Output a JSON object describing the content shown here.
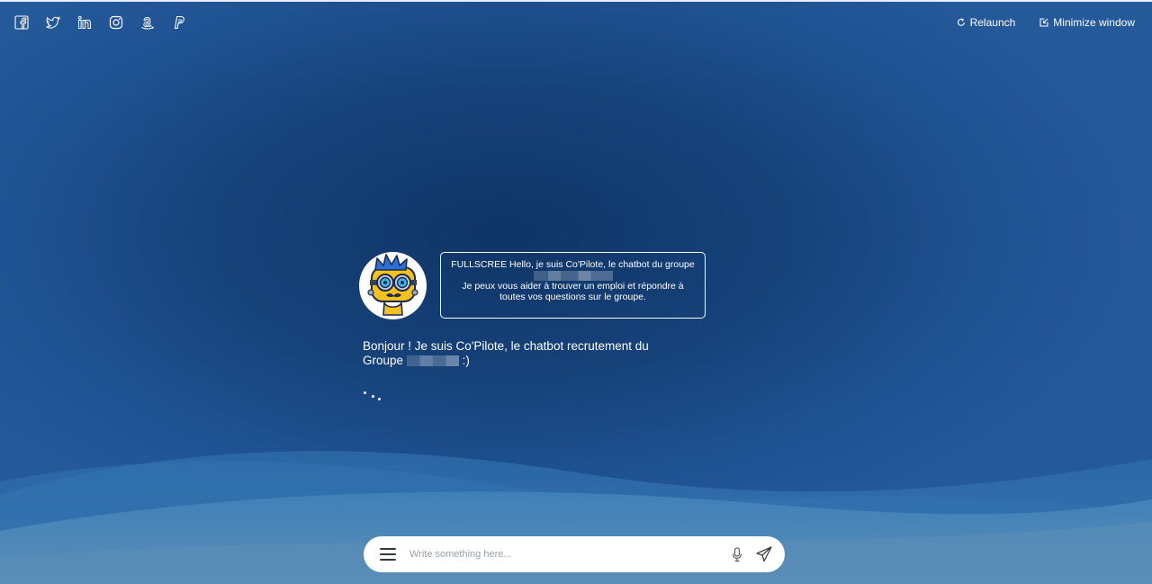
{
  "window": {
    "relaunch_label": "Relaunch",
    "minimize_label": "Minimize window"
  },
  "social_icons": [
    "facebook-icon",
    "twitter-icon",
    "linkedin-icon",
    "instagram-icon",
    "amazon-icon",
    "paypal-icon"
  ],
  "bot": {
    "avatar_icon": "robot-avatar",
    "intro_line1": "FULLSCREE Hello, je suis Co'Pilote, le chatbot du groupe",
    "intro_line2": "Je peux vous aider à trouver un emploi et répondre à toutes vos questions sur le groupe.",
    "greeting_prefix": "Bonjour ! Je suis Co'Pilote, le chatbot recrutement du Groupe",
    "greeting_suffix": ":)",
    "typing_indicator_icon": "typing-dots"
  },
  "composer": {
    "placeholder": "Write something here...",
    "menu_icon": "hamburger-menu-icon",
    "mic_icon": "microphone-icon",
    "send_icon": "paper-plane-icon"
  },
  "colors": {
    "background_dark": "#0f3566",
    "background_light": "#24599a",
    "wave_light": "#3f80b8",
    "accent_yellow": "#f5c21b"
  }
}
